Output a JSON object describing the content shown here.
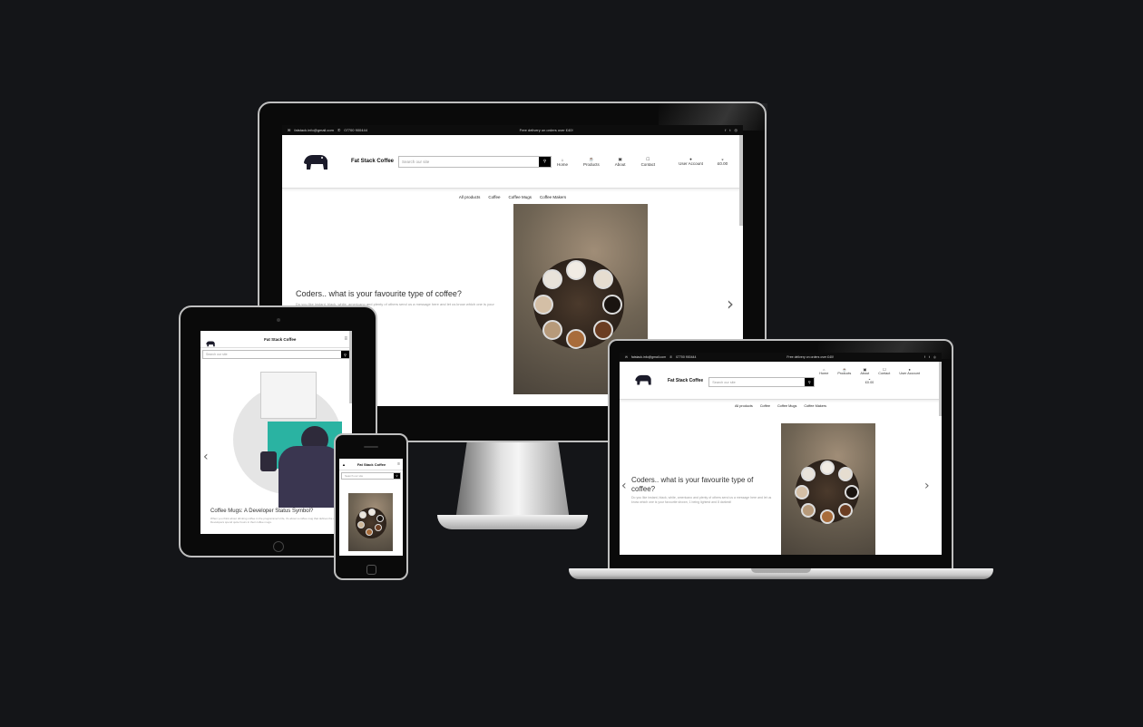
{
  "desktop": {
    "topbar": {
      "email": "fatstack.info@gmail.com",
      "phone": "07700 900444",
      "promo": "Free delivery on orders over £40!"
    },
    "brand": "Fat Stack Coffee",
    "search_placeholder": "Search our site",
    "nav": [
      {
        "label": "Home",
        "icon": "⌂"
      },
      {
        "label": "Products",
        "icon": "☕"
      },
      {
        "label": "About",
        "icon": "▣"
      },
      {
        "label": "Contact",
        "icon": "☐"
      }
    ],
    "account": "User Account",
    "cart_total": "£0.00",
    "categories": [
      "All products",
      "Coffee",
      "Coffee Mugs",
      "Coffee Makers"
    ],
    "hero_title": "Coders.. what is your favourite type of coffee?",
    "hero_body": "Do you like instant, black, white, americano and plenty of others send us a message here and let us know which one is your favourite shown, 1 being lightest and 8 darkest!"
  },
  "tablet": {
    "brand": "Fat Stack Coffee",
    "search_placeholder": "Search our site",
    "caption": "Coffee Mugs: A Developer Status Symbol?",
    "caption_body": "When you think about drinking coffee in the programmer's life, it's about a coffee mug that defines the developer. Developers spend quite hours in their coffee mugs."
  },
  "phone": {
    "brand": "Fat Stack Coffee",
    "search_placeholder": "Search our site"
  },
  "laptop": {
    "topbar": {
      "email": "fatstack.info@gmail.com",
      "phone": "07700 900444",
      "promo": "Free delivery on orders over £40!"
    },
    "brand": "Fat Stack Coffee",
    "search_placeholder": "Search our site",
    "nav": [
      {
        "label": "Home",
        "icon": "⌂"
      },
      {
        "label": "Products",
        "icon": "☕"
      },
      {
        "label": "About",
        "icon": "▣"
      },
      {
        "label": "Contact",
        "icon": "☐"
      }
    ],
    "account": "User Account",
    "cart_total": "£0.00",
    "categories": [
      "All products",
      "Coffee",
      "Coffee Mugs",
      "Coffee Makers"
    ],
    "hero_title": "Coders.. what is your favourite type of coffee?",
    "hero_body": "Do you like instant, black, white, americano and plenty of others send us a message here and let us know which one is your favourite shown, 1 being lightest and 8 darkest!"
  },
  "colors": {
    "background": "#141518",
    "bezel": "#0a0a0a",
    "accent": "#000000"
  },
  "icons": {
    "envelope": "✉",
    "phone": "✆",
    "facebook": "f",
    "twitter": "t",
    "instagram": "◎",
    "search": "⚲",
    "user": "👤",
    "cart": "🛒",
    "chevron_right": "›",
    "chevron_left": "‹"
  }
}
